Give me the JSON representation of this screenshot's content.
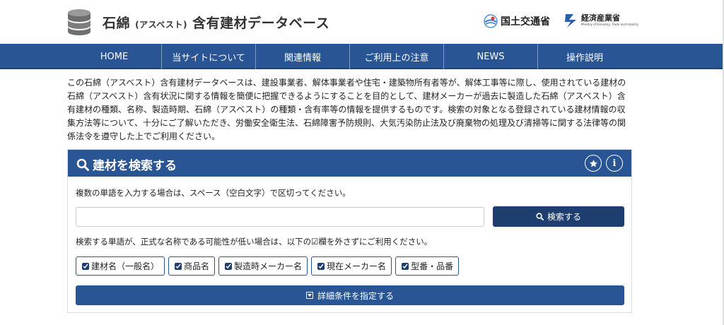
{
  "header": {
    "title_main_a": "石綿",
    "title_paren": "(アスベスト)",
    "title_main_b": "含有建材データベース",
    "mlit_label": "国土交通省",
    "meti_label": "経済産業省",
    "meti_en": "Ministry of Economy, Trade and Industry"
  },
  "nav": {
    "items": [
      {
        "label": "HOME"
      },
      {
        "label": "当サイトについて"
      },
      {
        "label": "関連情報"
      },
      {
        "label": "ご利用上の注意"
      },
      {
        "label": "NEWS"
      },
      {
        "label": "操作説明"
      }
    ]
  },
  "intro": {
    "text": "この石綿（アスベスト）含有建材データベースは、建設事業者、解体事業者や住宅・建築物所有者等が、解体工事等に際し、使用されている建材の石綿（アスベスト）含有状況に関する情報を簡便に把握できるようにすることを目的として、建材メーカーが過去に製造した石綿（アスベスト）含有建材の種類、名称、製造時期、石綿（アスベスト）の種類・含有率等の情報を提供するものです。検索の対象となる登録されている建材情報の収集方法等について、十分にご了解いただき、労働安全衛生法、石綿障害予防規則、大気汚染防止法及び廃棄物の処理及び清掃等に関する法律等の関係法令を遵守した上でご利用ください。"
  },
  "search": {
    "title": "建材を検索する",
    "hint1": "複数の単語を入力する場合は、スペース（空白文字）で区切ってください。",
    "input_value": "",
    "button_label": "検索する",
    "hint2": "検索する単語が、正式な名称である可能性が低い場合は、以下の☑欄を外さずにご利用ください。",
    "checkboxes": [
      {
        "label": "建材名（一般名）",
        "checked": true
      },
      {
        "label": "商品名",
        "checked": true
      },
      {
        "label": "製造時メーカー名",
        "checked": true
      },
      {
        "label": "現在メーカー名",
        "checked": true
      },
      {
        "label": "型番・品番",
        "checked": true
      }
    ],
    "detail_label": "詳細条件を指定する"
  },
  "colors": {
    "nav_blue": "#2a5595",
    "button_dark": "#1e3e70"
  }
}
